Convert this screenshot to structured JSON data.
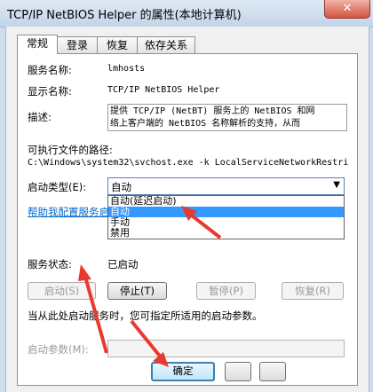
{
  "window": {
    "title": "TCP/IP NetBIOS Helper 的属性(本地计算机)",
    "close": "✕"
  },
  "tabs": [
    "常规",
    "登录",
    "恢复",
    "依存关系"
  ],
  "general": {
    "service_name_label": "服务名称:",
    "service_name": "lmhosts",
    "display_name_label": "显示名称:",
    "display_name": "TCP/IP NetBIOS Helper",
    "description_label": "描述:",
    "description_line1": "提供 TCP/IP (NetBT) 服务上的 NetBIOS 和网",
    "description_line2": "络上客户端的 NetBIOS 名称解析的支持，从而",
    "exe_path_label": "可执行文件的路径:",
    "exe_path": "C:\\Windows\\system32\\svchost.exe -k LocalServiceNetworkRestri",
    "startup_type_label": "启动类型(E):",
    "startup_type_value": "自动",
    "startup_options": [
      "自动(延迟启动)",
      "自动",
      "手动",
      "禁用"
    ],
    "startup_selected_index": 1,
    "help_link": "帮助我配置服务启动",
    "status_label": "服务状态:",
    "status_value": "已启动",
    "buttons": {
      "start": "启动(S)",
      "stop": "停止(T)",
      "pause": "暂停(P)",
      "resume": "恢复(R)"
    },
    "hint": "当从此处启动服务时，您可指定所适用的启动参数。",
    "params_label": "启动参数(M):",
    "params_value": ""
  },
  "footer": {
    "ok": "确定"
  },
  "colors": {
    "annotation": "#e83a30",
    "selection": "#3399ff"
  }
}
